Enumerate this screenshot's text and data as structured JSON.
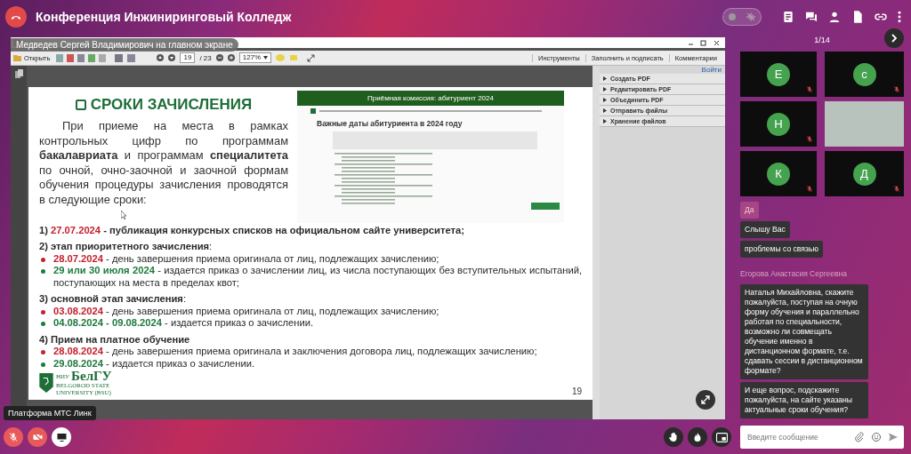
{
  "conference": {
    "title": "Конференция Инжиниринговый Колледж"
  },
  "noise_suppression": {
    "on": false
  },
  "screen_share": {
    "presenter_label": "Медведев Сергей Владимирович на главном экране"
  },
  "reader": {
    "open_label": "Открыть",
    "page": "19",
    "page_total": "/ 23",
    "zoom": "127%",
    "tabs": [
      "Инструменты",
      "Заполнить и подписать",
      "Комментарии"
    ],
    "login_link": "Войти",
    "panel_items": [
      "Создать PDF",
      "Редактировать PDF",
      "Объединить PDF",
      "Отправить файлы",
      "Хранение файлов"
    ]
  },
  "slide": {
    "title": "СРОКИ ЗАЧИСЛЕНИЯ",
    "intro": "При приеме на места в рамках контрольных цифр по программам **бакалавриата** и программам **специалитета** по очной, очно-заочной и заочной формам обучения процедуры зачисления проводятся в следующие сроки:",
    "website": {
      "header": "Приёмная комиссия: абитуриент 2024",
      "heading": "Важные даты абитуриента в 2024 году"
    },
    "schedule": [
      {
        "kind": "headline",
        "number": "1)",
        "date": "27.07.2024",
        "color": "#c4222e",
        "text": "- публикация конкурсных списков на официальном сайте университета;"
      },
      {
        "kind": "heading",
        "text": "**2) этап приоритетного зачисления**:"
      },
      {
        "kind": "bullet",
        "date": "28.07.2024",
        "color": "#c4222e",
        "text": "- день завершения приема оригинала от лиц, подлежащих зачислению;"
      },
      {
        "kind": "bullet",
        "date": "29 или 30 июля 2024",
        "color": "#1f7a3e",
        "text": "- издается приказ о зачислении лиц, из числа поступающих без вступительных испытаний, поступающих на места в пределах квот;"
      },
      {
        "kind": "heading",
        "text": "**3) основной этап зачисления**:"
      },
      {
        "kind": "bullet",
        "date": "03.08.2024",
        "color": "#c4222e",
        "text": "- день завершения приема оригинала от лиц, подлежащих зачислению;"
      },
      {
        "kind": "bullet",
        "date": "04.08.2024 - 09.08.2024",
        "color": "#1f7a3e",
        "text": "- издается приказ о зачислении."
      },
      {
        "kind": "heading",
        "text": "**4) Прием на платное обучение**"
      },
      {
        "kind": "bullet",
        "date": "28.08.2024",
        "color": "#c4222e",
        "text": "- день завершения приема оригинала и заключения договора лиц, подлежащих зачислению;"
      },
      {
        "kind": "bullet",
        "date": "29.08.2024",
        "color": "#1f7a3e",
        "text": "- издается приказ о зачислении."
      }
    ],
    "logo": {
      "top": "НИУ",
      "name": "БелГУ",
      "line1": "BELGOROD STATE",
      "line2": "UNIVERSITY (BSU)"
    },
    "page_number": "19"
  },
  "bottom_tooltip": "Платформа МТС Линк",
  "controls": [
    {
      "kind": "mic",
      "on": false
    },
    {
      "kind": "camera",
      "on": false
    },
    {
      "kind": "screen",
      "on": true
    }
  ],
  "pager": "1/14",
  "participants": [
    {
      "kind": "avatar",
      "initial": "Е",
      "muted": true
    },
    {
      "kind": "avatar",
      "initial": "с",
      "muted": true
    },
    {
      "kind": "avatar",
      "initial": "Н",
      "muted": true
    },
    {
      "kind": "video",
      "muted": false
    },
    {
      "kind": "avatar",
      "initial": "К",
      "muted": true
    },
    {
      "kind": "avatar",
      "initial": "Д",
      "muted": true
    }
  ],
  "chat": [
    {
      "kind": "message",
      "own": true,
      "text": "Да"
    },
    {
      "kind": "message",
      "own": false,
      "text": "Слышу Вас"
    },
    {
      "kind": "message",
      "own": false,
      "text": "проблемы со связью"
    },
    {
      "kind": "sender",
      "text": "Егорова Анастасия Сергеевна"
    },
    {
      "kind": "message",
      "own": false,
      "text": "Наталья Михайловна, скажите пожалуйста, поступая на очную форму обучения и параллельно работая по специальности, возможно ли совмещать обучение именно в дистанционном формате, т.е. сдавать сессии в дистанционном формате?"
    },
    {
      "kind": "message",
      "own": false,
      "text": "И еще вопрос, подскажите пожалуйста, на сайте указаны актуальные сроки обучения?"
    }
  ],
  "chat_input": {
    "placeholder": "Введите сообщение"
  }
}
